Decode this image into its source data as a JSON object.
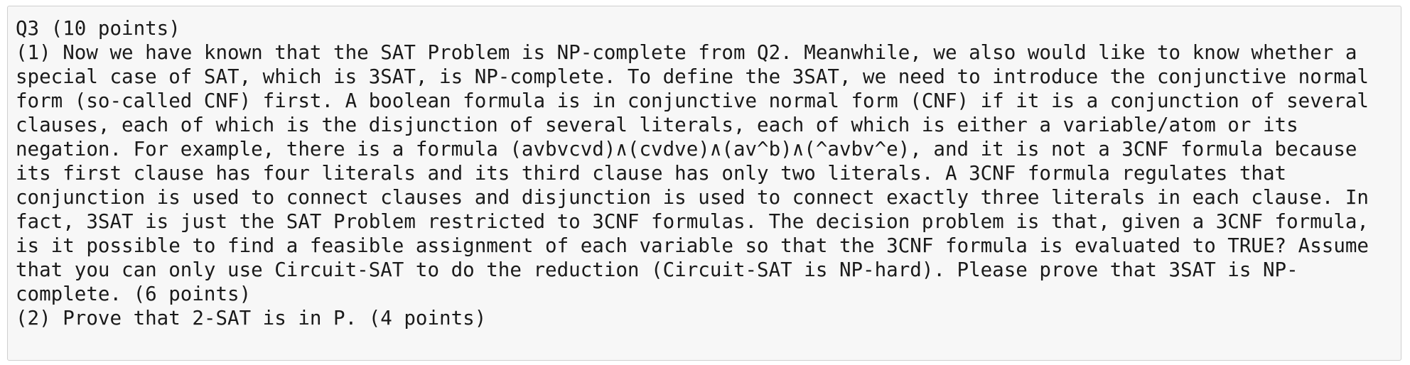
{
  "question": {
    "lines": [
      "Q3 (10 points)",
      "(1) Now we have known that the SAT Problem is NP-complete from Q2. Meanwhile, we also would like to know whether a",
      "special case of SAT, which is 3SAT, is NP-complete. To define the 3SAT, we need to introduce the conjunctive normal",
      "form (so-called CNF) first. A boolean formula is in conjunctive normal form (CNF) if it is a conjunction of several",
      "clauses, each of which is the disjunction of several literals, each of which is either a variable/atom or its",
      "negation. For example, there is a formula (avbvcvd)∧(cvdve)∧(av^b)∧(^avbv^e), and it is not a 3CNF formula because",
      "its first clause has four literals and its third clause has only two literals. A 3CNF formula regulates that",
      "conjunction is used to connect clauses and disjunction is used to connect exactly three literals in each clause. In",
      "fact, 3SAT is just the SAT Problem restricted to 3CNF formulas. The decision problem is that, given a 3CNF formula,",
      "is it possible to find a feasible assignment of each variable so that the 3CNF formula is evaluated to TRUE? Assume",
      "that you can only use Circuit-SAT to do the reduction (Circuit-SAT is NP-hard). Please prove that 3SAT is NP-",
      "complete. (6 points)",
      "(2) Prove that 2-SAT is in P. (4 points)"
    ]
  }
}
